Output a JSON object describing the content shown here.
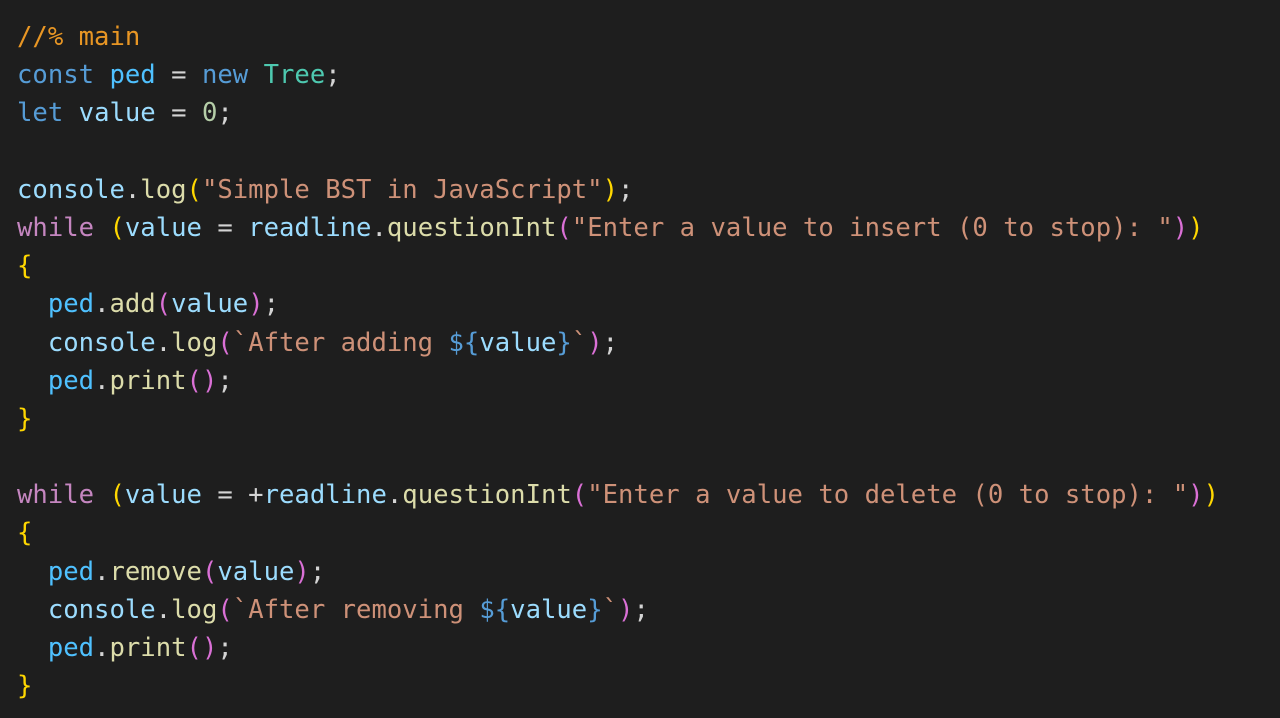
{
  "colors": {
    "background": "#1e1e1e",
    "comment": "#e89624",
    "keyword": "#569cd6",
    "control": "#c586c0",
    "variable": "#4fc1ff",
    "param": "#9cdcfe",
    "class": "#4ec9b0",
    "function": "#dcdcaa",
    "string": "#ce9178",
    "number": "#b5cea8",
    "punct": "#d4d4d4",
    "bracket1": "#ffd700",
    "bracket2": "#da70d6",
    "bracket3": "#179fff"
  },
  "lines": [
    [
      [
        "//% main",
        "comment"
      ]
    ],
    [
      [
        "const",
        "keyword"
      ],
      [
        " ",
        "punct"
      ],
      [
        "ped",
        "variable"
      ],
      [
        " = ",
        "punct"
      ],
      [
        "new",
        "keyword"
      ],
      [
        " ",
        "punct"
      ],
      [
        "Tree",
        "class"
      ],
      [
        ";",
        "punct"
      ]
    ],
    [
      [
        "let",
        "keyword"
      ],
      [
        " ",
        "punct"
      ],
      [
        "value",
        "param"
      ],
      [
        " = ",
        "punct"
      ],
      [
        "0",
        "number"
      ],
      [
        ";",
        "punct"
      ]
    ],
    [],
    [
      [
        "console",
        "param"
      ],
      [
        ".",
        "punct"
      ],
      [
        "log",
        "function"
      ],
      [
        "(",
        "bracket1"
      ],
      [
        "\"Simple BST in JavaScript\"",
        "string"
      ],
      [
        ")",
        "bracket1"
      ],
      [
        ";",
        "punct"
      ]
    ],
    [
      [
        "while",
        "control"
      ],
      [
        " ",
        "punct"
      ],
      [
        "(",
        "bracket1"
      ],
      [
        "value",
        "param"
      ],
      [
        " = ",
        "punct"
      ],
      [
        "readline",
        "param"
      ],
      [
        ".",
        "punct"
      ],
      [
        "questionInt",
        "function"
      ],
      [
        "(",
        "bracket2"
      ],
      [
        "\"Enter a value to insert (0 to stop): \"",
        "string"
      ],
      [
        ")",
        "bracket2"
      ],
      [
        ")",
        "bracket1"
      ]
    ],
    [
      [
        "{",
        "bracket1"
      ]
    ],
    [
      [
        "  ",
        "punct"
      ],
      [
        "ped",
        "variable"
      ],
      [
        ".",
        "punct"
      ],
      [
        "add",
        "function"
      ],
      [
        "(",
        "bracket2"
      ],
      [
        "value",
        "param"
      ],
      [
        ")",
        "bracket2"
      ],
      [
        ";",
        "punct"
      ]
    ],
    [
      [
        "  ",
        "punct"
      ],
      [
        "console",
        "param"
      ],
      [
        ".",
        "punct"
      ],
      [
        "log",
        "function"
      ],
      [
        "(",
        "bracket2"
      ],
      [
        "`After adding ",
        "string"
      ],
      [
        "${",
        "keyword"
      ],
      [
        "value",
        "param"
      ],
      [
        "}",
        "keyword"
      ],
      [
        "`",
        "string"
      ],
      [
        ")",
        "bracket2"
      ],
      [
        ";",
        "punct"
      ]
    ],
    [
      [
        "  ",
        "punct"
      ],
      [
        "ped",
        "variable"
      ],
      [
        ".",
        "punct"
      ],
      [
        "print",
        "function"
      ],
      [
        "()",
        "bracket2"
      ],
      [
        ";",
        "punct"
      ]
    ],
    [
      [
        "}",
        "bracket1"
      ]
    ],
    [],
    [
      [
        "while",
        "control"
      ],
      [
        " ",
        "punct"
      ],
      [
        "(",
        "bracket1"
      ],
      [
        "value",
        "param"
      ],
      [
        " = ",
        "punct"
      ],
      [
        "+",
        "punct"
      ],
      [
        "readline",
        "param"
      ],
      [
        ".",
        "punct"
      ],
      [
        "questionInt",
        "function"
      ],
      [
        "(",
        "bracket2"
      ],
      [
        "\"Enter a value to delete (0 to stop): \"",
        "string"
      ],
      [
        ")",
        "bracket2"
      ],
      [
        ")",
        "bracket1"
      ]
    ],
    [
      [
        "{",
        "bracket1"
      ]
    ],
    [
      [
        "  ",
        "punct"
      ],
      [
        "ped",
        "variable"
      ],
      [
        ".",
        "punct"
      ],
      [
        "remove",
        "function"
      ],
      [
        "(",
        "bracket2"
      ],
      [
        "value",
        "param"
      ],
      [
        ")",
        "bracket2"
      ],
      [
        ";",
        "punct"
      ]
    ],
    [
      [
        "  ",
        "punct"
      ],
      [
        "console",
        "param"
      ],
      [
        ".",
        "punct"
      ],
      [
        "log",
        "function"
      ],
      [
        "(",
        "bracket2"
      ],
      [
        "`After removing ",
        "string"
      ],
      [
        "${",
        "keyword"
      ],
      [
        "value",
        "param"
      ],
      [
        "}",
        "keyword"
      ],
      [
        "`",
        "string"
      ],
      [
        ")",
        "bracket2"
      ],
      [
        ";",
        "punct"
      ]
    ],
    [
      [
        "  ",
        "punct"
      ],
      [
        "ped",
        "variable"
      ],
      [
        ".",
        "punct"
      ],
      [
        "print",
        "function"
      ],
      [
        "()",
        "bracket2"
      ],
      [
        ";",
        "punct"
      ]
    ],
    [
      [
        "}",
        "bracket1"
      ]
    ]
  ]
}
